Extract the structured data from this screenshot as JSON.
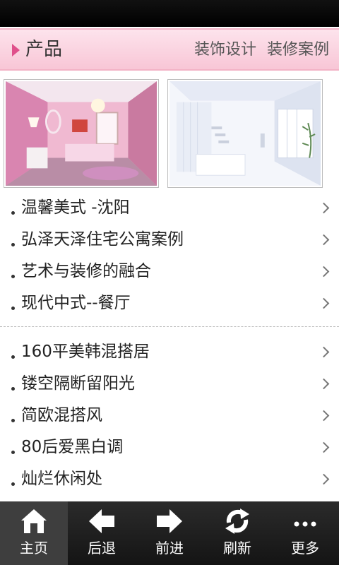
{
  "header": {
    "title": "产品",
    "links": [
      "装饰设计",
      "装修案例"
    ]
  },
  "thumbnails": [
    {
      "icon": "pink-bedroom-photo"
    },
    {
      "icon": "white-living-room-photo"
    }
  ],
  "list_group_1": [
    {
      "label": "温馨美式 -沈阳"
    },
    {
      "label": "弘泽天泽住宅公寓案例"
    },
    {
      "label": "艺术与装修的融合"
    },
    {
      "label": "现代中式--餐厅"
    }
  ],
  "list_group_2": [
    {
      "label": "160平美韩混搭居"
    },
    {
      "label": "镂空隔断留阳光"
    },
    {
      "label": "简欧混搭风"
    },
    {
      "label": "80后爱黑白调"
    },
    {
      "label": "灿烂休闲处"
    }
  ],
  "tabbar": {
    "items": [
      {
        "label": "主页",
        "icon": "home-icon",
        "active": true
      },
      {
        "label": "后退",
        "icon": "back-arrow-icon"
      },
      {
        "label": "前进",
        "icon": "forward-arrow-icon"
      },
      {
        "label": "刷新",
        "icon": "refresh-icon"
      },
      {
        "label": "更多",
        "icon": "more-icon"
      }
    ]
  },
  "colors": {
    "header_bg": "#f8c6d6",
    "accent": "#e0508b",
    "tabbar_bg": "#1a1a1a"
  }
}
